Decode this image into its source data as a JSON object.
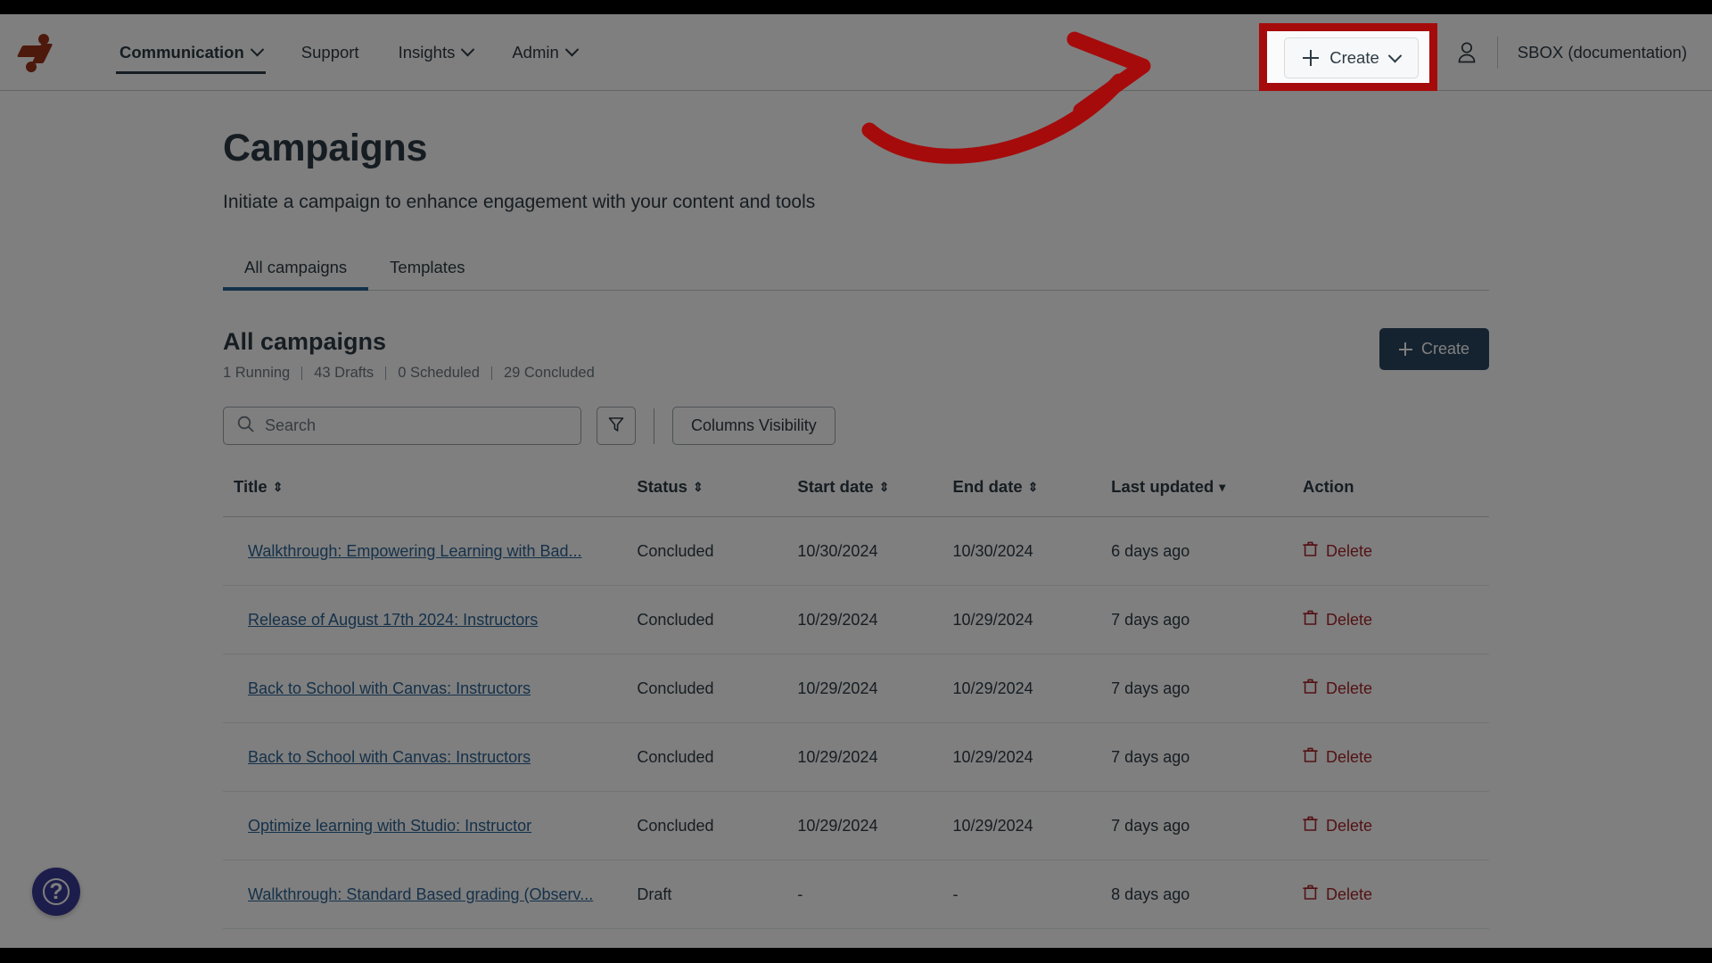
{
  "topnav": {
    "logo_name": "impact-logo",
    "items": [
      {
        "label": "Communication",
        "has_caret": true,
        "active": true
      },
      {
        "label": "Support",
        "has_caret": false,
        "active": false
      },
      {
        "label": "Insights",
        "has_caret": true,
        "active": false
      },
      {
        "label": "Admin",
        "has_caret": true,
        "active": false
      }
    ],
    "create_button": {
      "label": "Create",
      "icon": "plus-icon",
      "caret": "chevron-down-icon"
    },
    "person_icon": "person-icon",
    "account_name": "SBOX (documentation)"
  },
  "page": {
    "title": "Campaigns",
    "subtitle": "Initiate a campaign to enhance engagement with your content and tools"
  },
  "tabs": [
    {
      "label": "All campaigns",
      "active": true
    },
    {
      "label": "Templates",
      "active": false
    }
  ],
  "section": {
    "title": "All campaigns",
    "counts": [
      "1 Running",
      "43 Drafts",
      "0 Scheduled",
      "29 Concluded"
    ],
    "create_button_label": "Create"
  },
  "toolbar": {
    "search_placeholder": "Search",
    "search_value": "",
    "search_icon": "search-icon",
    "filter_icon": "filter-icon",
    "columns_visibility_label": "Columns Visibility"
  },
  "table": {
    "columns": [
      {
        "label": "Title",
        "sort": "both"
      },
      {
        "label": "Status",
        "sort": "both"
      },
      {
        "label": "Start date",
        "sort": "both"
      },
      {
        "label": "End date",
        "sort": "both"
      },
      {
        "label": "Last updated",
        "sort": "desc"
      },
      {
        "label": "Action",
        "sort": "none"
      }
    ],
    "delete_label": "Delete",
    "rows": [
      {
        "title": "Walkthrough: Empowering Learning with Bad...",
        "status": "Concluded",
        "start_date": "10/30/2024",
        "end_date": "10/30/2024",
        "last_updated": "6 days ago"
      },
      {
        "title": "Release of August 17th 2024: Instructors",
        "status": "Concluded",
        "start_date": "10/29/2024",
        "end_date": "10/29/2024",
        "last_updated": "7 days ago"
      },
      {
        "title": "Back to School with Canvas: Instructors",
        "status": "Concluded",
        "start_date": "10/29/2024",
        "end_date": "10/29/2024",
        "last_updated": "7 days ago"
      },
      {
        "title": "Back to School with Canvas: Instructors",
        "status": "Concluded",
        "start_date": "10/29/2024",
        "end_date": "10/29/2024",
        "last_updated": "7 days ago"
      },
      {
        "title": "Optimize learning with Studio: Instructor",
        "status": "Concluded",
        "start_date": "10/29/2024",
        "end_date": "10/29/2024",
        "last_updated": "7 days ago"
      },
      {
        "title": "Walkthrough: Standard Based grading (Observ...",
        "status": "Draft",
        "start_date": "-",
        "end_date": "-",
        "last_updated": "8 days ago"
      }
    ]
  },
  "help": {
    "icon": "question-mark-icon"
  },
  "annotation": {
    "arrow_color": "#a60b0b",
    "highlight_color": "#a60b0b",
    "target_label": "Create"
  },
  "colors": {
    "brand_red": "#9b3219",
    "link_blue": "#2b6394",
    "primary_button": "#2b4661",
    "tab_accent": "#2b6394",
    "delete_red": "#a8242a",
    "text": "#2d3b45",
    "muted_text": "#6b7780",
    "help_purple": "#3b3b98"
  }
}
